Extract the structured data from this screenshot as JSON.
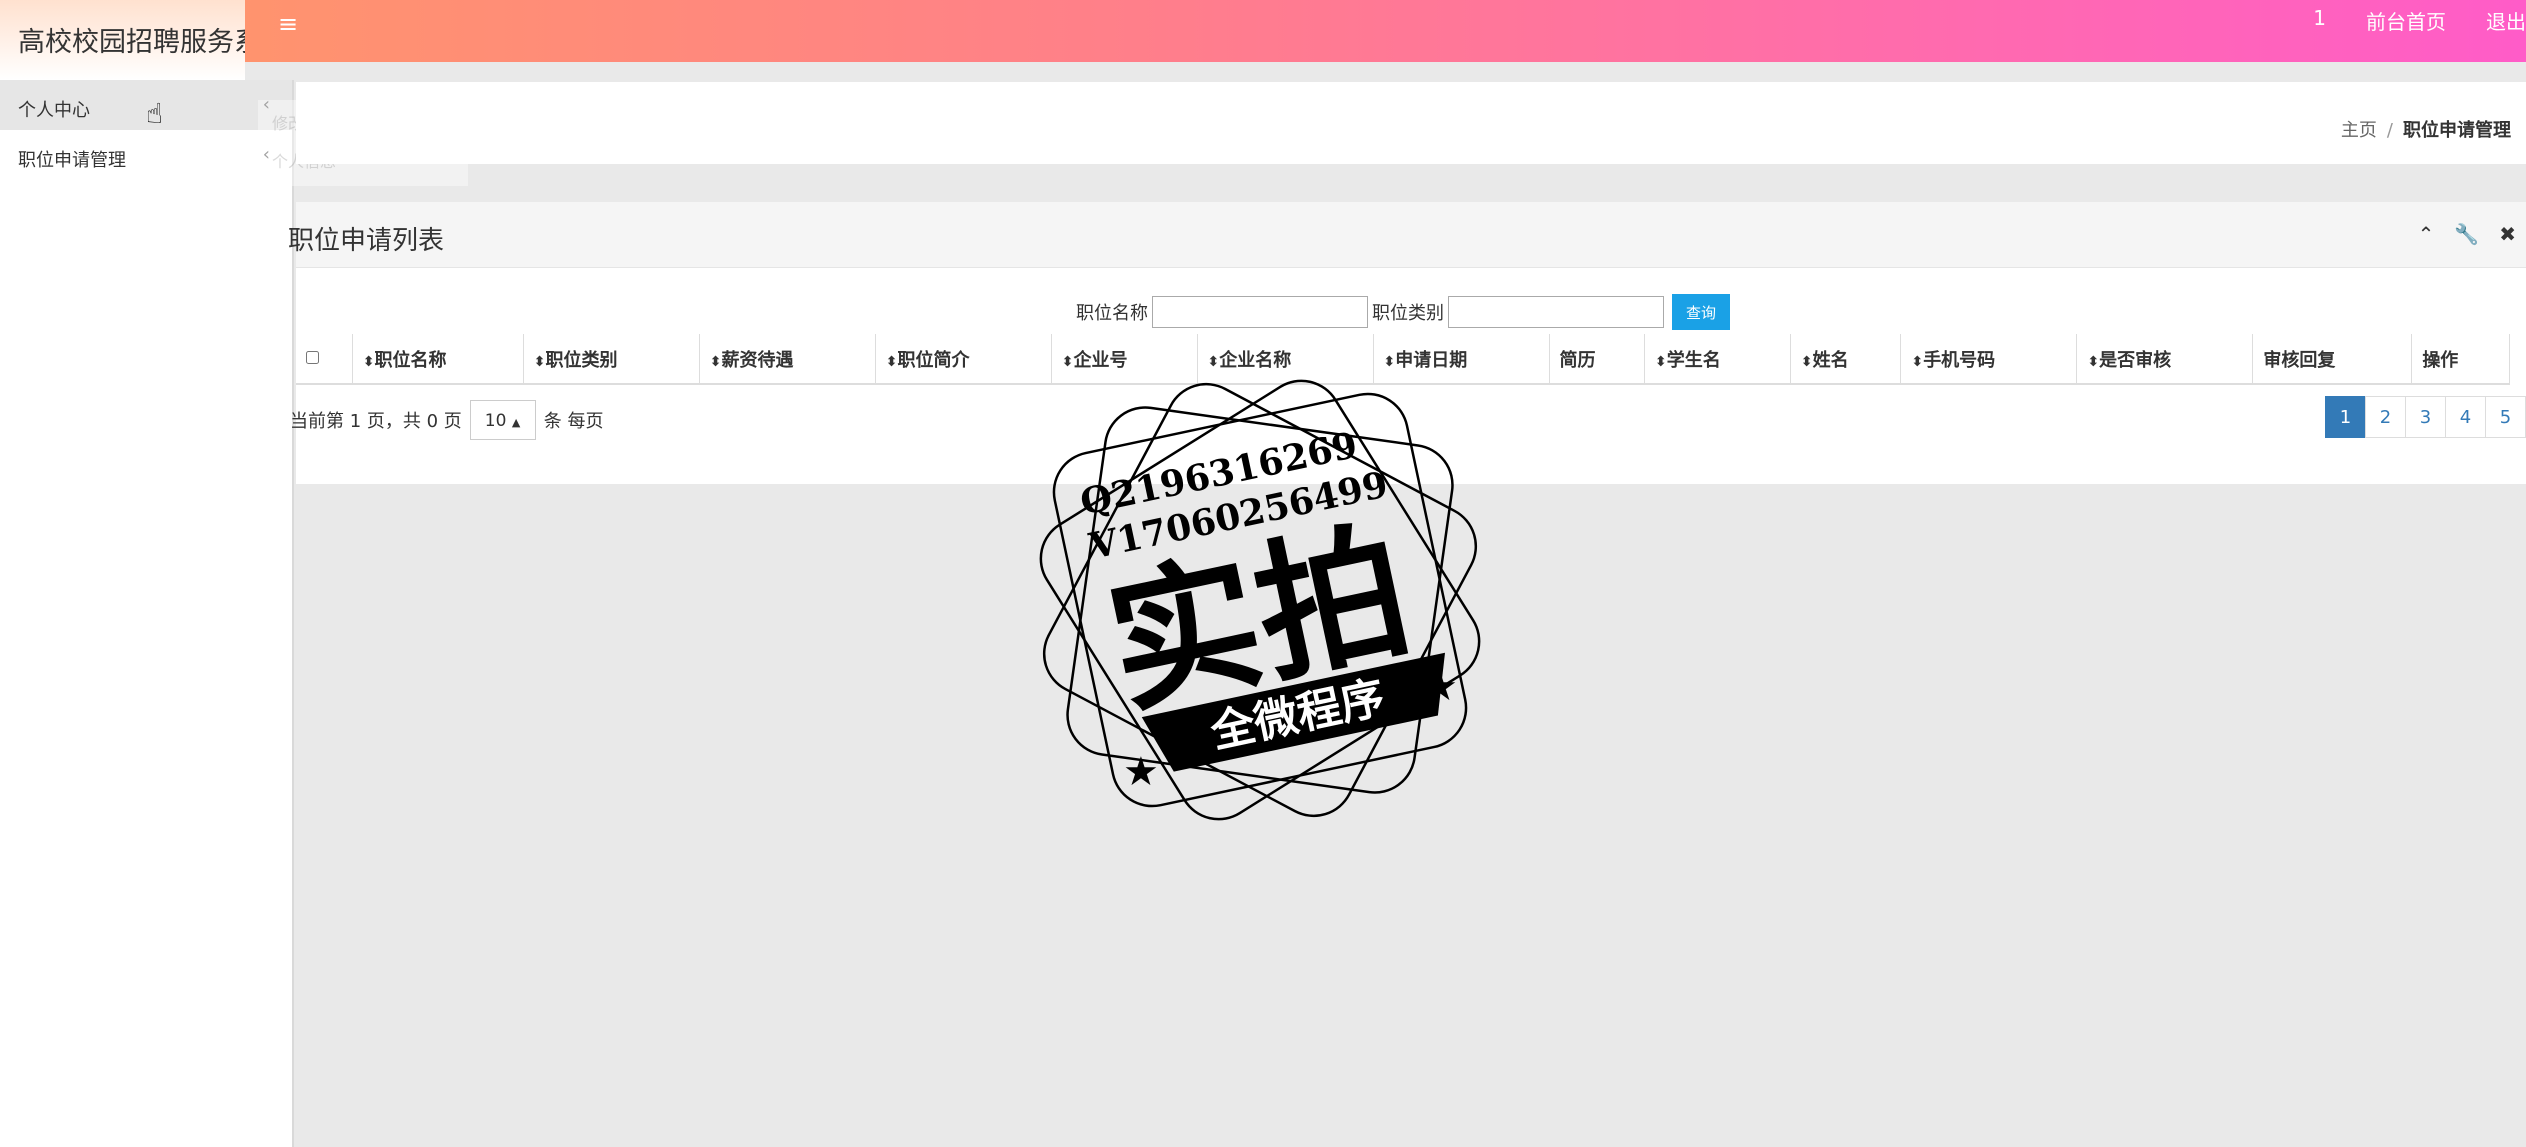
{
  "app": {
    "title": "高校校园招聘服务系"
  },
  "topbar": {
    "menu_icon": "hamburger-icon",
    "user": "1",
    "front_home": "前台首页",
    "logout": "退出"
  },
  "sidebar": {
    "items": [
      {
        "label": "个人中心",
        "chevron": "‹"
      },
      {
        "label": "职位申请管理",
        "chevron": "‹"
      }
    ],
    "ghost_sub": [
      "修改密码",
      "个人信息"
    ]
  },
  "breadcrumb": {
    "home": "主页",
    "sep": "/",
    "current": "职位申请管理"
  },
  "panel": {
    "title": "职位申请列表"
  },
  "search": {
    "label1": "职位名称",
    "value1": "",
    "label2": "职位类别",
    "value2": "",
    "button": "查询"
  },
  "table": {
    "columns": [
      {
        "label": "",
        "checkbox": true
      },
      {
        "label": "职位名称",
        "sortable": true
      },
      {
        "label": "职位类别",
        "sortable": true
      },
      {
        "label": "薪资待遇",
        "sortable": true
      },
      {
        "label": "职位简介",
        "sortable": true
      },
      {
        "label": "企业号",
        "sortable": true
      },
      {
        "label": "企业名称",
        "sortable": true
      },
      {
        "label": "申请日期",
        "sortable": true
      },
      {
        "label": "简历",
        "sortable": false
      },
      {
        "label": "学生名",
        "sortable": true
      },
      {
        "label": "姓名",
        "sortable": true
      },
      {
        "label": "手机号码",
        "sortable": true
      },
      {
        "label": "是否审核",
        "sortable": true
      },
      {
        "label": "审核回复",
        "sortable": false
      },
      {
        "label": "操作",
        "sortable": false
      }
    ],
    "rows": []
  },
  "pager": {
    "info": "当前第 1 页，共 0 页",
    "page_size": "10",
    "per_page_text": "条 每页",
    "pages": [
      "1",
      "2",
      "3",
      "4",
      "5"
    ],
    "active": "1"
  },
  "watermark": {
    "line1": "Q2196316269",
    "line2": "V17060256499",
    "big": "实拍",
    "banner": "全微程序"
  }
}
